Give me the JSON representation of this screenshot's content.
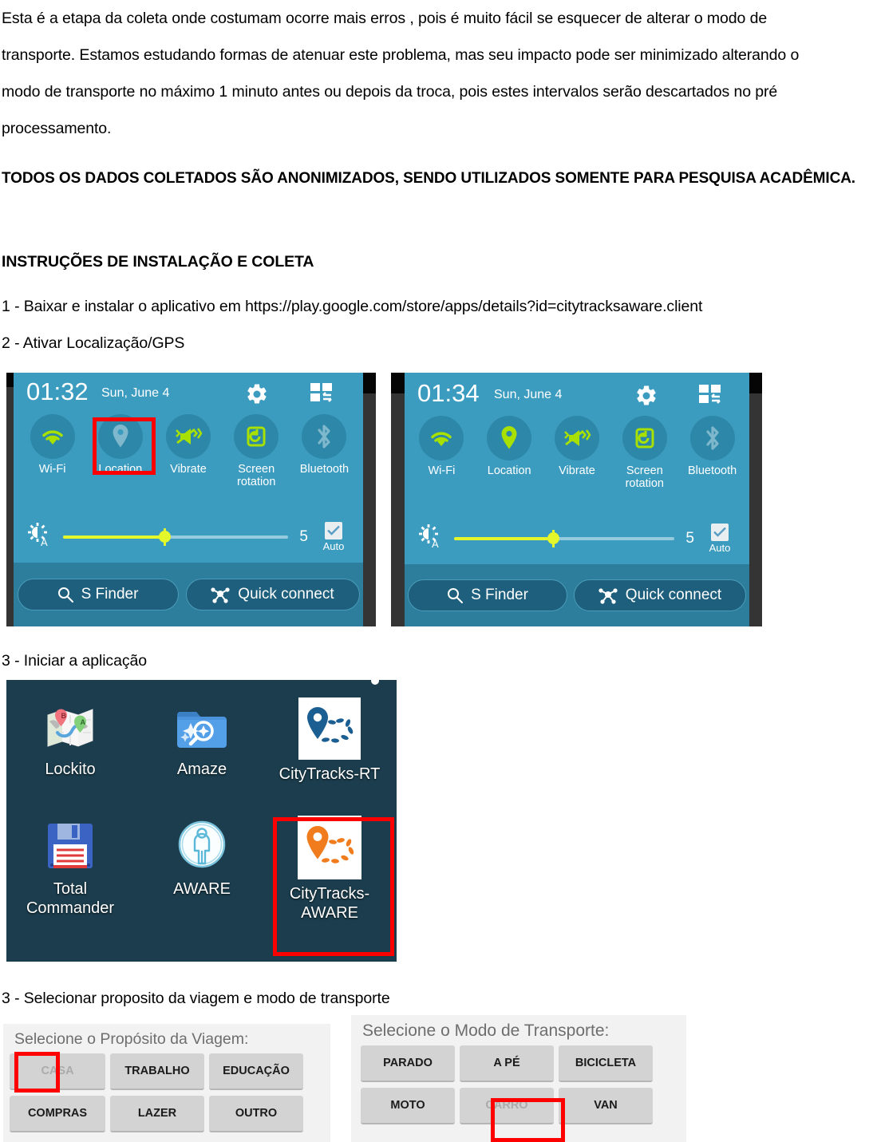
{
  "document": {
    "paragraphs": [
      "Esta é a etapa da coleta onde costumam ocorre mais erros , pois é muito fácil se esquecer de alterar o modo de",
      "transporte.  Estamos estudando formas de atenuar este problema, mas seu impacto pode ser minimizado alterando o",
      "modo de transporte no máximo 1 minuto antes ou depois da troca, pois estes intervalos serão descartados no pré",
      "processamento."
    ],
    "notice": "TODOS OS DADOS COLETADOS SÃO ANONIMIZADOS, SENDO UTILIZADOS SOMENTE PARA PESQUISA ACADÊMICA.",
    "section_heading": "INSTRUÇÕES DE INSTALAÇÃO E COLETA",
    "step1": "1 - Baixar e instalar o aplicativo em https://play.google.com/store/apps/details?id=citytracksaware.client",
    "step2": "2 - Ativar Localização/GPS",
    "step3a": "3 - Iniciar a aplicação",
    "step3b": "3 - Selecionar proposito da viagem e modo de transporte"
  },
  "quick_settings_before": {
    "clock": "01:32",
    "date": "Sun, June 4",
    "toggles": [
      {
        "label": "Wi-Fi",
        "icon": "wifi-icon",
        "state": "on"
      },
      {
        "label": "Location",
        "icon": "location-pin-icon",
        "state": "off"
      },
      {
        "label": "Vibrate",
        "icon": "vibrate-icon",
        "state": "on"
      },
      {
        "label": "Screen\nrotation",
        "icon": "screen-rotation-icon",
        "state": "on"
      },
      {
        "label": "Bluetooth",
        "icon": "bluetooth-icon",
        "state": "off"
      }
    ],
    "brightness_value": "5",
    "auto_label": "Auto",
    "s_finder": "S Finder",
    "quick_connect": "Quick connect",
    "highlight": "Location"
  },
  "quick_settings_after": {
    "clock": "01:34",
    "date": "Sun, June 4",
    "toggles": [
      {
        "label": "Wi-Fi",
        "icon": "wifi-icon",
        "state": "on"
      },
      {
        "label": "Location",
        "icon": "location-pin-icon",
        "state": "on"
      },
      {
        "label": "Vibrate",
        "icon": "vibrate-icon",
        "state": "on"
      },
      {
        "label": "Screen\nrotation",
        "icon": "screen-rotation-icon",
        "state": "on"
      },
      {
        "label": "Bluetooth",
        "icon": "bluetooth-icon",
        "state": "off"
      }
    ],
    "brightness_value": "5",
    "auto_label": "Auto",
    "s_finder": "S Finder",
    "quick_connect": "Quick connect",
    "highlight": "none"
  },
  "app_drawer": {
    "apps": [
      {
        "label": "Lockito",
        "icon": "map-route-icon"
      },
      {
        "label": "Amaze",
        "icon": "folder-search-icon"
      },
      {
        "label": "CityTracks-RT",
        "icon": "blue-pin-track-icon"
      },
      {
        "label": "Total\nCommander",
        "icon": "floppy-disk-icon"
      },
      {
        "label": "AWARE",
        "icon": "person-circle-icon"
      },
      {
        "label": "CityTracks-\nAWARE",
        "icon": "orange-pin-track-icon"
      }
    ],
    "highlight": "CityTracks-AWARE"
  },
  "purpose_panel": {
    "title": "Selecione o Propósito da Viagem:",
    "buttons": [
      "CASA",
      "TRABALHO",
      "EDUCAÇÃO",
      "COMPRAS",
      "LAZER",
      "OUTRO"
    ],
    "selected": "CASA"
  },
  "transport_panel": {
    "title": "Selecione o Modo de Transporte:",
    "buttons": [
      "PARADO",
      "A PÉ",
      "BICICLETA",
      "MOTO",
      "CARRO",
      "VAN"
    ],
    "selected": "CARRO"
  },
  "colors": {
    "panel_blue": "#3c9cc0",
    "panel_bottom_blue": "#2d7d9c",
    "toggle_circle": "#2d87a8",
    "accent_green": "#a8e000",
    "slider_yellow": "#e4f72b",
    "drawer_bg": "#1b3d4d",
    "highlight_red": "#ff0000",
    "selector_bg": "#f2f2f2",
    "button_gray": "#d3d3d3"
  }
}
